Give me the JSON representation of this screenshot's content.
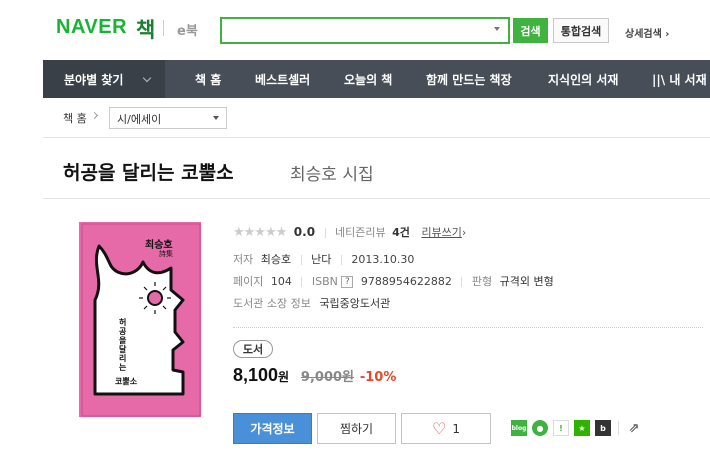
{
  "header": {
    "logo": "NAVER",
    "service": "책",
    "ebook": "e북",
    "search_value": "",
    "search_button": "검색",
    "total_search_button": "통합검색",
    "detail_search_link": "상세검색 ›"
  },
  "nav": {
    "category": "분야별 찾기",
    "items": [
      "책 홈",
      "베스트셀러",
      "오늘의 책",
      "함께 만드는 책장",
      "지식인의 서재",
      "||\\ 내 서재"
    ]
  },
  "breadcrumb": {
    "home": "책 홈",
    "selected": "시/에세이"
  },
  "book": {
    "title": "허공을 달리는 코뿔소",
    "subtitle": "최승호 시집",
    "cover": {
      "author": "최승호",
      "sub": "詩集",
      "title": "허공을 달리는",
      "title2": "코뿔소",
      "color": "#e66aa8"
    },
    "rating": {
      "stars": "★★★★★",
      "score": "0.0",
      "review_label": "네티즌리뷰",
      "review_count": "4건",
      "write_review": "리뷰쓰기"
    },
    "author_label": "저자",
    "author": "최승호",
    "publisher": "난다",
    "date": "2013.10.30",
    "pages_label": "페이지",
    "pages": "104",
    "isbn_label": "ISBN",
    "isbn_q": "?",
    "isbn": "9788954622882",
    "format_label": "판형",
    "format": "규격외 변형",
    "library_label": "도서관 소장 정보",
    "library": "국립중앙도서관",
    "type_badge": "도서",
    "price": "8,100",
    "price_unit": "원",
    "original_price": "9,000원",
    "discount": "-10%",
    "buttons": {
      "price_info": "가격정보",
      "wish": "찜하기",
      "like_count": "1"
    }
  },
  "colors": {
    "naver_green": "#19b436",
    "nav_bg": "#474e57",
    "price_button": "#4a90d9",
    "discount": "#e04a2e"
  }
}
